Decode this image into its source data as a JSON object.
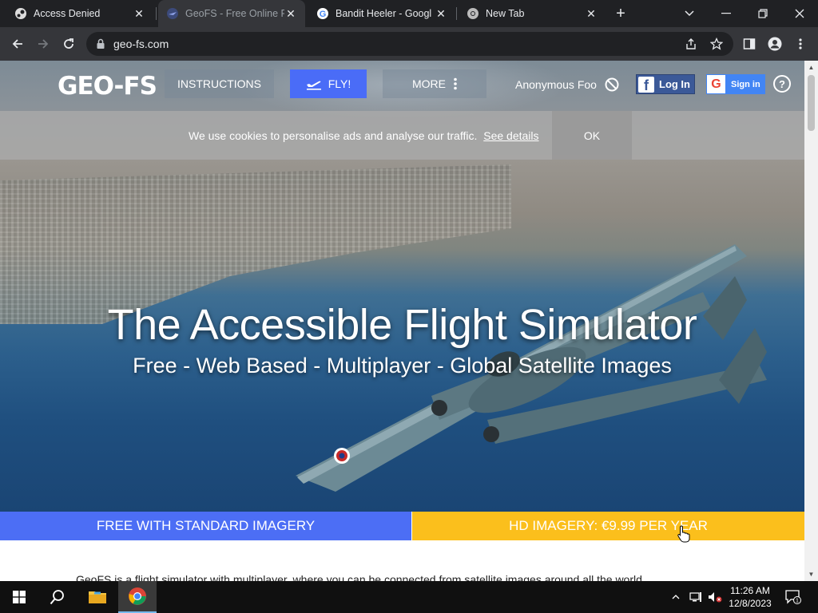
{
  "browser": {
    "tabs": [
      {
        "title": "Access Denied",
        "icon": "steam-icon",
        "active": false
      },
      {
        "title": "GeoFS - Free Online Fli",
        "icon": "geofs-icon",
        "active": true
      },
      {
        "title": "Bandit Heeler - Googl",
        "icon": "google-icon",
        "active": false
      },
      {
        "title": "New Tab",
        "icon": "chrome-icon",
        "active": false
      }
    ],
    "url": "geo-fs.com"
  },
  "site": {
    "logo": "GEO-FS",
    "nav": {
      "instructions": "INSTRUCTIONS",
      "fly": "FLY!",
      "more": "MORE",
      "user": "Anonymous Foo",
      "facebook_login": "Log In",
      "google_signin": "Sign in",
      "help": "?"
    },
    "cookie": {
      "message": "We use cookies to personalise ads and analyse our traffic.",
      "link": "See details",
      "ok": "OK"
    },
    "hero": {
      "title": "The Accessible Flight Simulator",
      "subtitle": "Free - Web Based - Multiplayer - Global Satellite Images"
    },
    "plans": {
      "free": "FREE WITH STANDARD IMAGERY",
      "hd": "HD IMAGERY: €9.99 PER YEAR"
    },
    "clipped_text": "GeoFS is a flight simulator with multiplayer, where you can be connected from satellite images around all the world"
  },
  "taskbar": {
    "time": "11:26 AM",
    "date": "12/8/2023",
    "notification_count": "1"
  },
  "colors": {
    "fly_button": "#4a6cf7",
    "free_plan": "#4c6ef5",
    "hd_plan": "#fbbf1c",
    "facebook": "#3b5998",
    "google": "#4285f4"
  }
}
